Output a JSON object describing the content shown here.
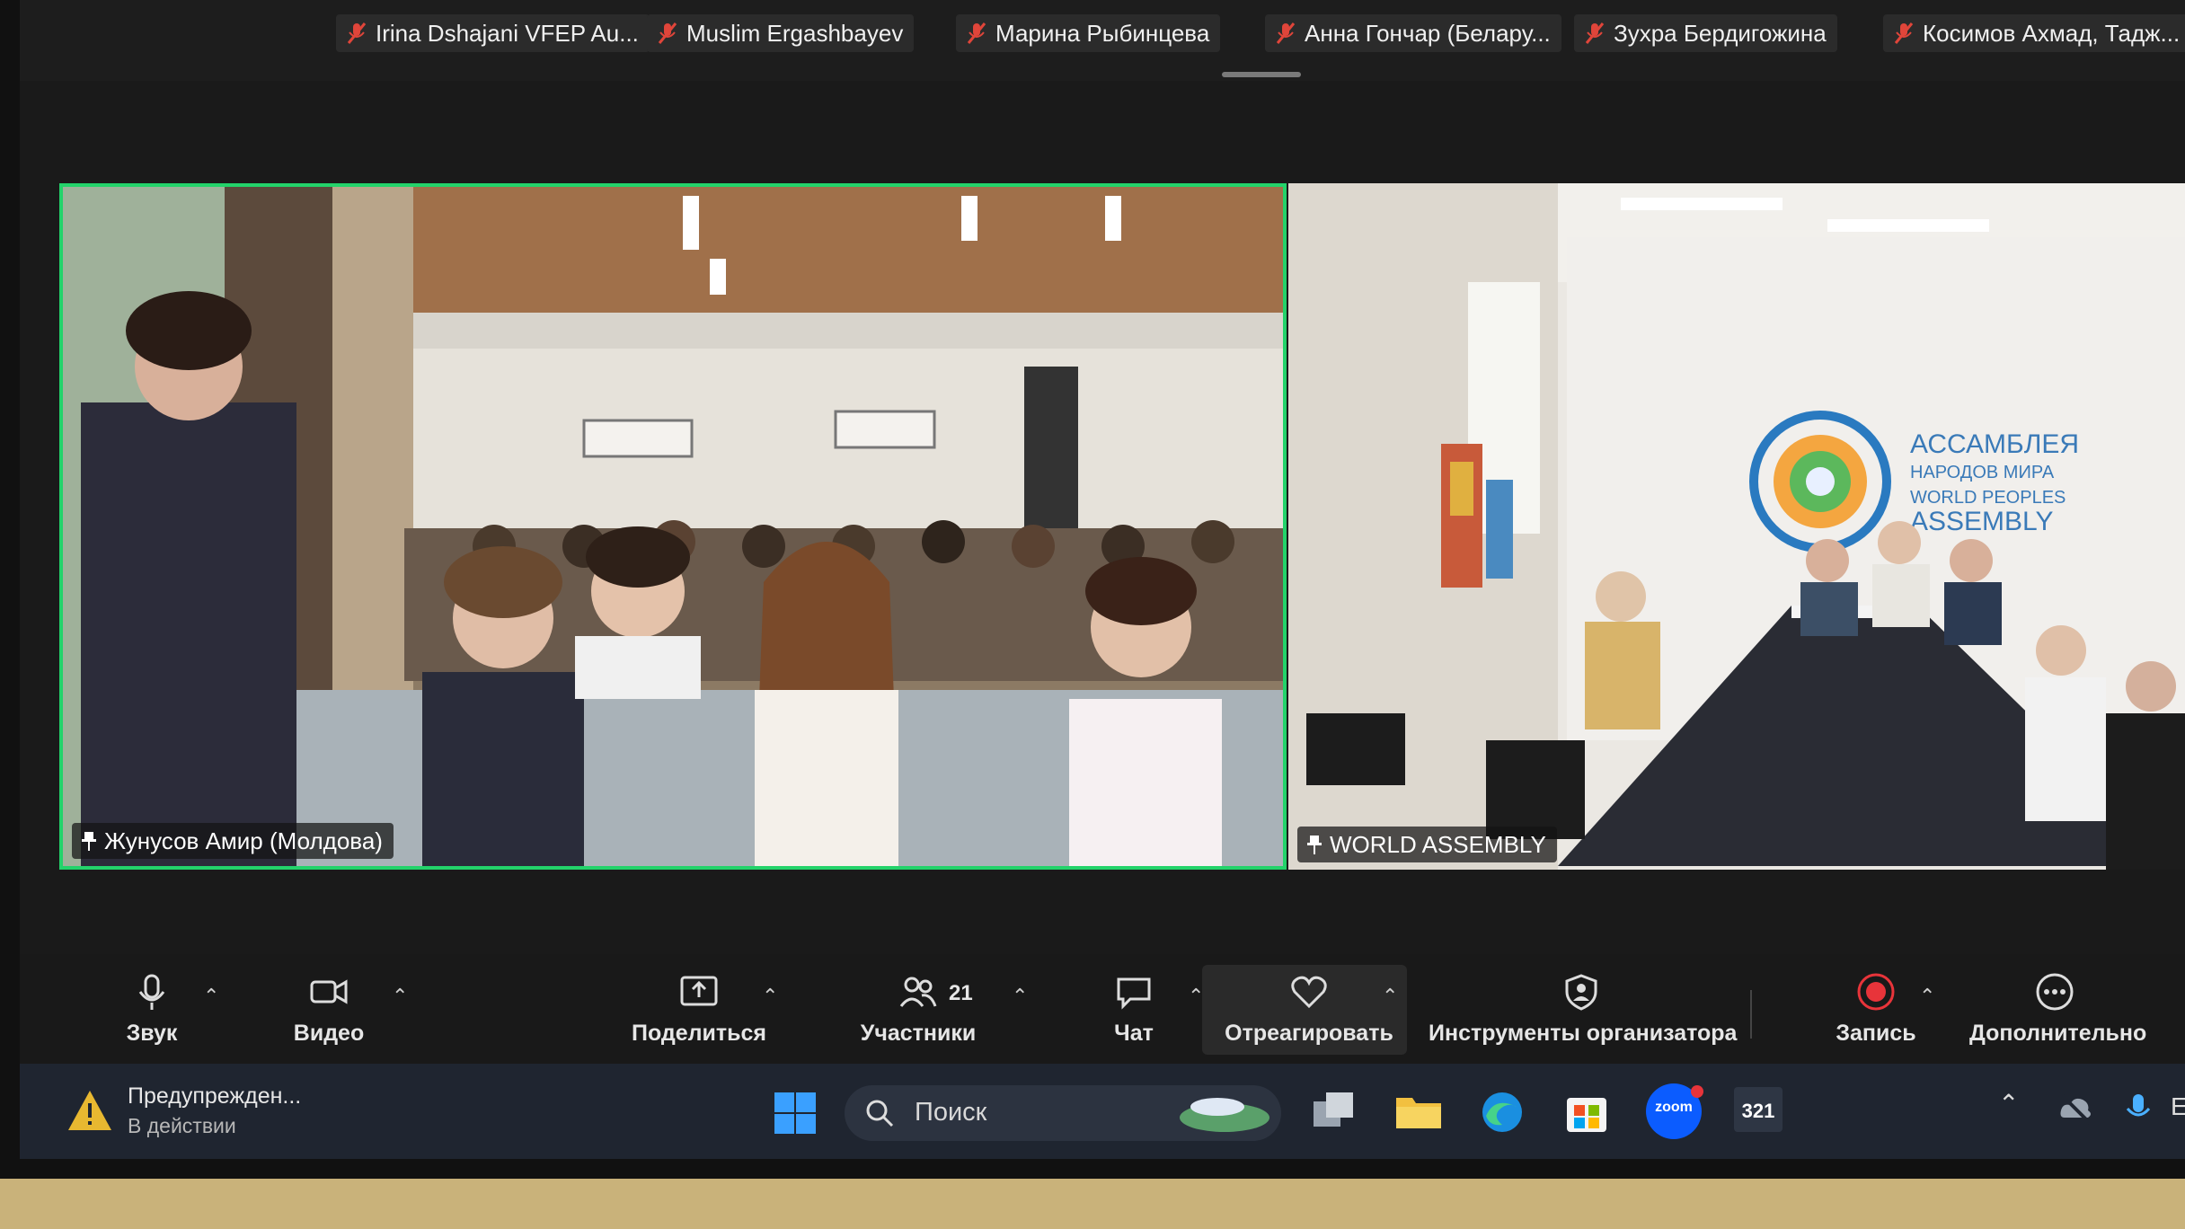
{
  "participants_strip": [
    {
      "name": "Irina Dshajani VFEP Au..."
    },
    {
      "name": "Muslim Ergashbayev"
    },
    {
      "name": "Марина Рыбинцева"
    },
    {
      "name": "Анна Гончар (Белару..."
    },
    {
      "name": "Зухра Бердигожина"
    },
    {
      "name": "Косимов Ахмад, Тадж..."
    }
  ],
  "videos": {
    "left": {
      "label": "Жунусов Амир (Молдова)"
    },
    "right": {
      "label": "WORLD ASSEMBLY",
      "banner_line1": "АССАМБЛЕЯ",
      "banner_line2": "НАРОДОВ МИРА",
      "banner_line3": "WORLD PEOPLES",
      "banner_line4": "ASSEMBLY"
    }
  },
  "toolbar": {
    "audio": "Звук",
    "video": "Видео",
    "share": "Поделиться",
    "participants": "Участники",
    "participants_count": "21",
    "chat": "Чат",
    "react": "Отреагировать",
    "host_tools": "Инструменты организатора",
    "record": "Запись",
    "more": "Дополнительно"
  },
  "taskbar": {
    "notification_title": "Предупрежден...",
    "notification_subtitle": "В действии",
    "search_placeholder": "Поиск",
    "zoom_label": "zoom",
    "calendar_badge": "321",
    "edge_letter": "E"
  },
  "colors": {
    "active_speaker_border": "#23d36a",
    "muted_mic": "#e0453a",
    "record_red": "#e8343a",
    "zoom_blue": "#0b5cff"
  }
}
